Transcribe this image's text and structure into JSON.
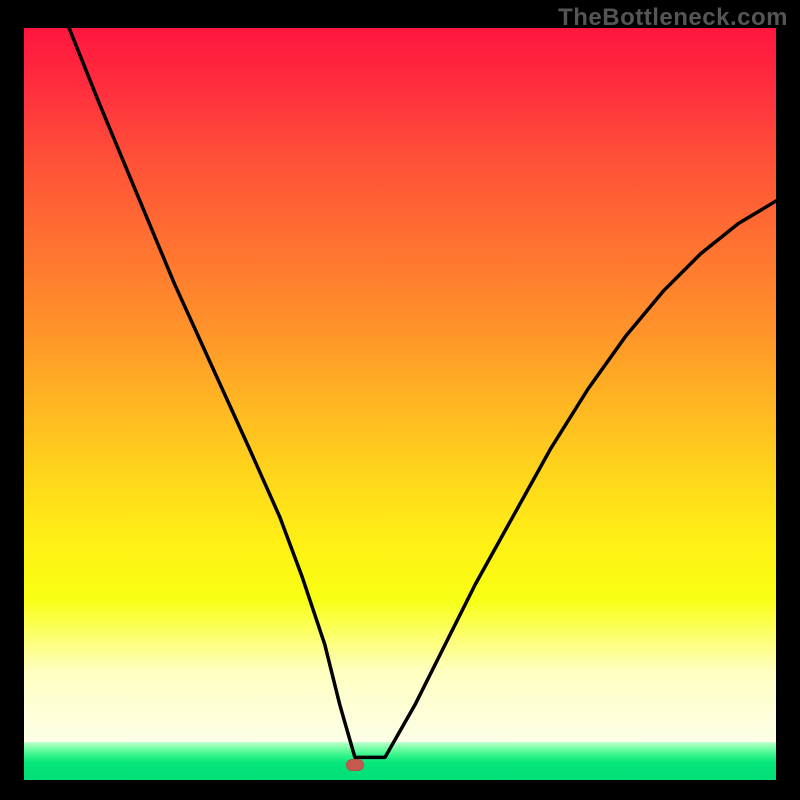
{
  "watermark": "TheBottleneck.com",
  "chart_data": {
    "type": "line",
    "title": "",
    "xlabel": "",
    "ylabel": "",
    "xlim": [
      0,
      100
    ],
    "ylim": [
      0,
      100
    ],
    "grid": false,
    "legend": false,
    "background_gradient": "red-yellow-green (vertical, red top green bottom)",
    "marker": {
      "x": 44,
      "y": 2,
      "color": "#c45a4f"
    },
    "series": [
      {
        "name": "curve",
        "color": "#000000",
        "x": [
          6,
          10,
          15,
          20,
          25,
          30,
          34,
          37,
          40,
          42,
          44,
          48,
          52,
          56,
          60,
          65,
          70,
          75,
          80,
          85,
          90,
          95,
          100
        ],
        "values": [
          100,
          90,
          78,
          66,
          55,
          44,
          35,
          27,
          18,
          10,
          3,
          3,
          10,
          18,
          26,
          35,
          44,
          52,
          59,
          65,
          70,
          74,
          77
        ]
      }
    ]
  }
}
